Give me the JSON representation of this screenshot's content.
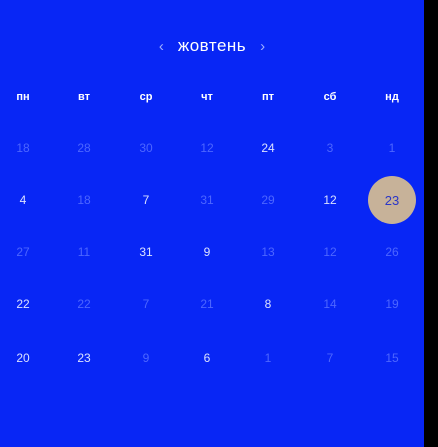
{
  "calendar": {
    "month": "жовтень",
    "prev_icon": "‹",
    "next_icon": "›",
    "weekdays": [
      "пн",
      "вт",
      "ср",
      "чт",
      "пт",
      "сб",
      "нд"
    ],
    "weeks": [
      [
        {
          "label": "18",
          "state": "dim"
        },
        {
          "label": "28",
          "state": "dim"
        },
        {
          "label": "30",
          "state": "dim"
        },
        {
          "label": "12",
          "state": "dim"
        },
        {
          "label": "24",
          "state": "cur"
        },
        {
          "label": "3",
          "state": "dim"
        },
        {
          "label": "1",
          "state": "dim"
        }
      ],
      [
        {
          "label": "4",
          "state": "cur"
        },
        {
          "label": "18",
          "state": "dim"
        },
        {
          "label": "7",
          "state": "cur"
        },
        {
          "label": "31",
          "state": "dim"
        },
        {
          "label": "29",
          "state": "dim"
        },
        {
          "label": "12",
          "state": "cur"
        },
        {
          "label": "23",
          "state": "selected"
        }
      ],
      [
        {
          "label": "27",
          "state": "dim"
        },
        {
          "label": "11",
          "state": "dim"
        },
        {
          "label": "31",
          "state": "cur"
        },
        {
          "label": "9",
          "state": "cur"
        },
        {
          "label": "13",
          "state": "dim"
        },
        {
          "label": "12",
          "state": "dim"
        },
        {
          "label": "26",
          "state": "dim"
        }
      ],
      [
        {
          "label": "22",
          "state": "cur"
        },
        {
          "label": "22",
          "state": "dim"
        },
        {
          "label": "7",
          "state": "dim"
        },
        {
          "label": "21",
          "state": "dim"
        },
        {
          "label": "8",
          "state": "cur"
        },
        {
          "label": "14",
          "state": "dim"
        },
        {
          "label": "19",
          "state": "dim"
        }
      ],
      [
        {
          "label": "20",
          "state": "cur"
        },
        {
          "label": "23",
          "state": "cur"
        },
        {
          "label": "9",
          "state": "dim"
        },
        {
          "label": "6",
          "state": "cur"
        },
        {
          "label": "1",
          "state": "dim"
        },
        {
          "label": "7",
          "state": "dim"
        },
        {
          "label": "15",
          "state": "dim"
        }
      ]
    ]
  },
  "colors": {
    "background": "#0826f5",
    "selected_day": "#c7b299",
    "selected_text": "#2a36c8",
    "outside_month_text": "#4d66ff"
  }
}
